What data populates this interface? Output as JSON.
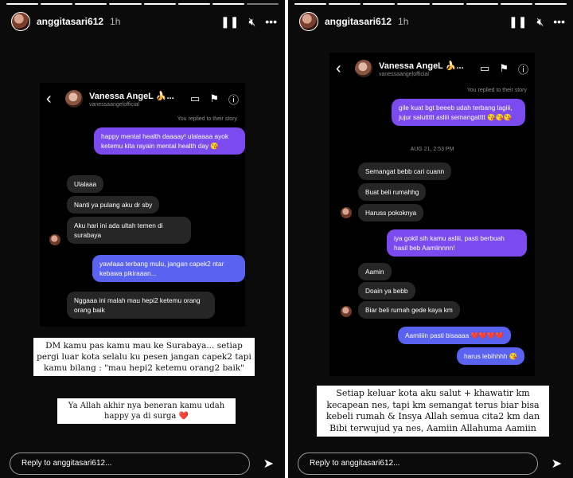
{
  "left": {
    "username": "anggitasari612",
    "time": "1h",
    "dm": {
      "name": "Vanessa AngeL 🍌...",
      "handle": "vanessaangelofficial",
      "replied_note": "You replied to their story",
      "messages": [
        {
          "from": "me",
          "text": "happy mental health daaaay! ulalaaaa ayok ketemu kita rayain mental health day 😘"
        },
        {
          "from": "them",
          "text": "Ulalaaa"
        },
        {
          "from": "them",
          "text": "Nanti ya pulang aku dr sby"
        },
        {
          "from": "them",
          "text": "Aku hari ini ada ultah temen di surabaya"
        },
        {
          "from": "me",
          "text": "yawlaaa terbang mulu, jangan capek2 ntar kebawa pikiraaan..."
        },
        {
          "from": "them",
          "text": "Nggaaa ini malah mau hepi2 ketemu orang orang baik"
        }
      ]
    },
    "caption1": "DM kamu pas kamu mau ke Surabaya... setiap pergi luar kota selalu ku pesen jangan capek2 tapi kamu bilang : \"mau hepi2 ketemu orang2 baik\"",
    "caption2_text": "Ya Allah akhir nya beneran kamu udah happy ya di surga",
    "caption2_emoji": "❤️",
    "reply_placeholder": "Reply to anggitasari612..."
  },
  "right": {
    "username": "anggitasari612",
    "time": "1h",
    "dm": {
      "name": "Vanessa AngeL 🍌...",
      "handle": "vanessaangelofficial",
      "replied_note": "You replied to their story",
      "timestamp": "AUG 21, 2:53 PM",
      "messages": [
        {
          "from": "me",
          "text": "gile kuat bgt beeeb udah terbang lagiii, jujur saluttttt asliii semangatttt 😘😘😘"
        },
        {
          "from": "them",
          "text": "Semangat bebb cari cuann"
        },
        {
          "from": "them",
          "text": "Buat beli rumahhg"
        },
        {
          "from": "them",
          "text": "Haruss pokoknya"
        },
        {
          "from": "me",
          "text": "iya gokil sih kamu asliii, pasti berbuah hasil beb Aamiinnnn!"
        },
        {
          "from": "them",
          "text": "Aamin"
        },
        {
          "from": "them",
          "text": "Doain ya bebb"
        },
        {
          "from": "them",
          "text": "Biar beli rumah gede kaya km"
        },
        {
          "from": "me",
          "text": "Aamiiiin pasti bisaaaa ❤️❤️❤️❤️"
        },
        {
          "from": "me",
          "text": "harus lebihhhh 😘"
        }
      ]
    },
    "caption": "Setiap keluar kota aku salut + khawatir km kecapean nes, tapi km semangat terus biar bisa kebeli rumah & Insya Allah semua cita2 km dan Bibi terwujud ya nes, Aamiin Allahuma Aamiin",
    "reply_placeholder": "Reply to anggitasari612..."
  },
  "icons": {
    "pause": "pause-icon",
    "mute": "mute-icon",
    "more": "more-icon",
    "back": "back-icon",
    "video": "video-icon",
    "flag": "flag-icon",
    "info": "info-icon",
    "send": "send-icon"
  },
  "colors": {
    "bubble_out": "#7c4bf0",
    "bubble_in": "#262626",
    "heart": "#e0245e"
  }
}
